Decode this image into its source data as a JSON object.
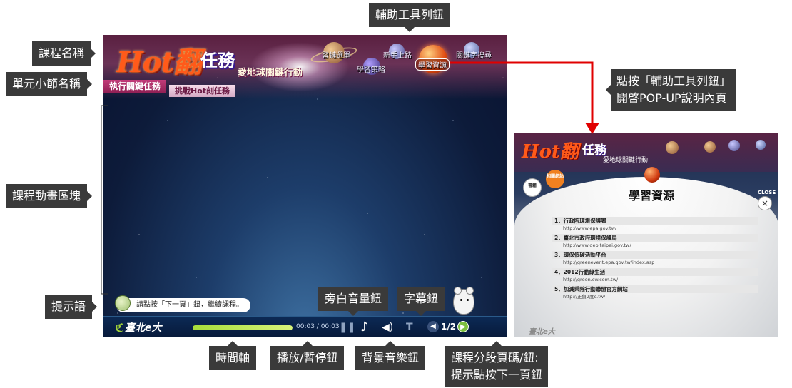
{
  "annotations": {
    "toolbar": "輔助工具列鈕",
    "course_name": "課程名稱",
    "unit_name": "單元小節名稱",
    "animation_area": "課程動畫區塊",
    "hint": "提示語",
    "narration_volume": "旁白音量鈕",
    "subtitle_btn": "字幕鈕",
    "timeline": "時間軸",
    "play_pause": "播放/暫停鈕",
    "bgm": "背景音樂鈕",
    "segment_line1": "課程分段頁碼/鈕:",
    "segment_line2": "提示點按下一頁鈕",
    "popup_line1": "點按「輔助工具列鈕」",
    "popup_line2": "開啓POP-UP說明內頁"
  },
  "course": {
    "brand": "Hot翻",
    "mission": "任務",
    "subtitle": "愛地球關鍵行動",
    "tab_active": "執行關鍵任務",
    "tab_inactive": "挑戰Hot刻任務"
  },
  "toolbar_planets": [
    {
      "label": "習鏈選單",
      "color": "#b07848"
    },
    {
      "label": "學習策略",
      "color": "#5a4a9a"
    },
    {
      "label": "新手上路",
      "color": "#6a6aa0"
    },
    {
      "label": "學習資源",
      "color": "#e04a10"
    },
    {
      "label": "關鍵字搜尋",
      "color": "#5a6aa8"
    }
  ],
  "hint_text": "請點按「下一頁」鈕，繼續課程。",
  "player": {
    "logo": "臺北e大",
    "progress": 1.0,
    "time": "00:03 / 00:03",
    "page": "1/2"
  },
  "popup": {
    "brand": "Hot翻",
    "mission": "任務",
    "subtitle": "愛地球關鍵行動",
    "bubble_books": "書籍",
    "bubble_links": "相關網站",
    "title": "學習資源",
    "close_label": "CLOSE",
    "close_icon": "×",
    "items": [
      {
        "title": "1．行政院環境保護署",
        "url": "http://www.epa.gov.tw/"
      },
      {
        "title": "2．臺北市政府環境保護局",
        "url": "http://www.dep.taipei.gov.tw/"
      },
      {
        "title": "3．環保低碳活動平台",
        "url": "http://greenevent.epa.gov.tw/index.asp"
      },
      {
        "title": "4．2012行動綠生活",
        "url": "http://green.cw.com.tw/"
      },
      {
        "title": "5．加減乘除行動聯盟官方網站",
        "url": "http://正負2度c.tw/"
      }
    ],
    "logo": "臺北e大"
  },
  "colors": {
    "arrow": "#e00000",
    "label_bg": "#3a3a3a"
  }
}
